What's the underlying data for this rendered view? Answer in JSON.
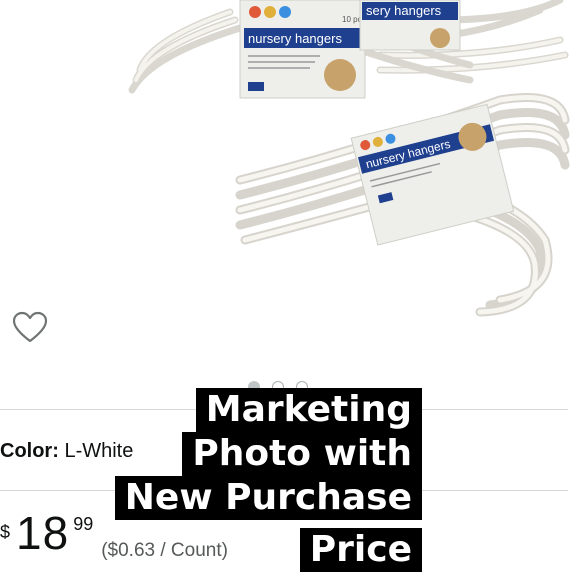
{
  "product": {
    "packages": [
      {
        "brand_badge": "○○○",
        "count": "10 pcs",
        "name": "nursery hangers"
      },
      {
        "brand_badge": "",
        "count": "",
        "name": "nursery hangers"
      },
      {
        "brand_badge": "○○○",
        "count": "",
        "name": "nursery hangers"
      }
    ]
  },
  "carousel": {
    "dots": 3,
    "active_index": 0
  },
  "icons": {
    "wishlist": "heart-outline-icon"
  },
  "selection": {
    "color_label": "Color:",
    "color_value": "L-White"
  },
  "price": {
    "currency": "$",
    "whole": "18",
    "fraction": "99",
    "unit_price": "($0.63 / Count)"
  },
  "overlay": {
    "line1": "Marketing",
    "line2": "Photo with",
    "line3": "New Purchase",
    "line4": "Price"
  },
  "colors": {
    "text": "#0f1111",
    "muted": "#565959",
    "divider": "#d5d9d9",
    "caption_bg": "#000000",
    "caption_text": "#ffffff"
  }
}
